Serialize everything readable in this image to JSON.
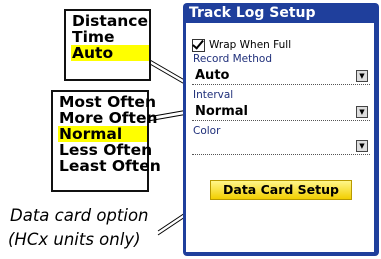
{
  "record_callout": {
    "options": [
      "Distance",
      "Time",
      "Auto"
    ],
    "selected_index": 2
  },
  "interval_callout": {
    "options": [
      "Most Often",
      "More Often",
      "Normal",
      "Less Often",
      "Least Often"
    ],
    "selected_index": 2
  },
  "caption": {
    "line1": "Data card option",
    "line2": "(HCx units only)"
  },
  "screen": {
    "title": "Track Log Setup",
    "wrap_when_full": {
      "label": "Wrap When Full",
      "checked": true
    },
    "record_method": {
      "label": "Record Method",
      "value": "Auto"
    },
    "interval": {
      "label": "Interval",
      "value": "Normal"
    },
    "color": {
      "label": "Color",
      "value": ""
    },
    "data_card_button": "Data Card Setup"
  },
  "colors": {
    "screen_blue": "#1f3f9c",
    "highlight": "#ffff00",
    "button_yellow": "#f2cf00"
  },
  "icons": {
    "dropdown": "dropdown-arrow-icon",
    "checkbox": "checkmark-icon"
  }
}
